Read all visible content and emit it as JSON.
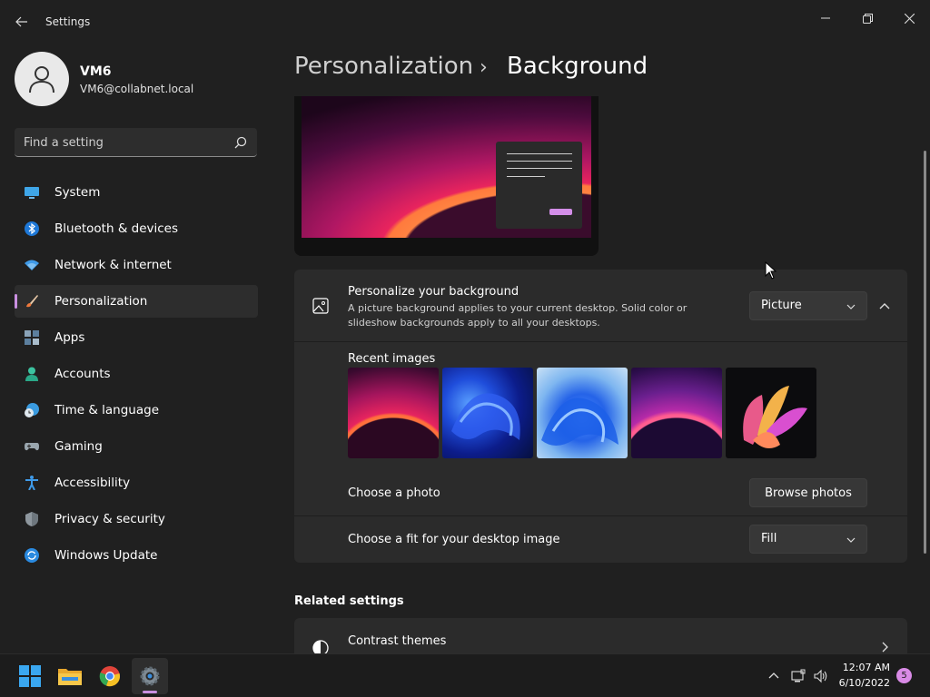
{
  "window": {
    "title": "Settings"
  },
  "profile": {
    "name": "VM6",
    "email": "VM6@collabnet.local"
  },
  "search": {
    "placeholder": "Find a setting",
    "value": ""
  },
  "sidebar": {
    "items": [
      {
        "label": "System",
        "icon": "monitor-icon"
      },
      {
        "label": "Bluetooth & devices",
        "icon": "bluetooth-icon"
      },
      {
        "label": "Network & internet",
        "icon": "wifi-icon"
      },
      {
        "label": "Personalization",
        "icon": "brush-icon",
        "active": true
      },
      {
        "label": "Apps",
        "icon": "apps-icon"
      },
      {
        "label": "Accounts",
        "icon": "person-icon"
      },
      {
        "label": "Time & language",
        "icon": "clock-globe-icon"
      },
      {
        "label": "Gaming",
        "icon": "gamepad-icon"
      },
      {
        "label": "Accessibility",
        "icon": "accessibility-icon"
      },
      {
        "label": "Privacy & security",
        "icon": "shield-icon"
      },
      {
        "label": "Windows Update",
        "icon": "update-icon"
      }
    ],
    "accent": "#c98fe0"
  },
  "header": {
    "parent": "Personalization",
    "separator": "›",
    "current": "Background"
  },
  "background_card": {
    "title": "Personalize your background",
    "description": "A picture background applies to your current desktop. Solid color or slideshow backgrounds apply to all your desktops.",
    "type_value": "Picture",
    "recent_label": "Recent images",
    "choose_photo_label": "Choose a photo",
    "browse_label": "Browse photos",
    "fit_label": "Choose a fit for your desktop image",
    "fit_value": "Fill"
  },
  "related": {
    "title": "Related settings",
    "contrast_label": "Contrast themes"
  },
  "taskbar": {
    "time": "12:07 AM",
    "date": "6/10/2022",
    "notification_count": "5"
  }
}
